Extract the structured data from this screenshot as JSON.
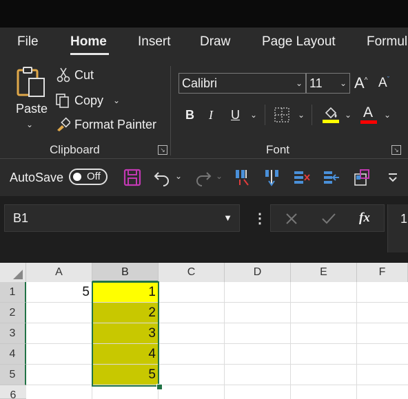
{
  "ribbon": {
    "tabs": [
      "File",
      "Home",
      "Insert",
      "Draw",
      "Page Layout",
      "Formul"
    ],
    "active_tab": "Home",
    "clipboard": {
      "paste_label": "Paste",
      "cut_label": "Cut",
      "copy_label": "Copy",
      "format_painter_label": "Format Painter",
      "group_label": "Clipboard"
    },
    "font": {
      "font_name": "Calibri",
      "font_size": "11",
      "bold": "B",
      "italic": "I",
      "underline": "U",
      "font_color_letter": "A",
      "grow_label": "A",
      "shrink_label": "A",
      "group_label": "Font",
      "highlight_color": "#ffff00",
      "font_color": "#ff0000"
    }
  },
  "qat": {
    "autosave_label": "AutoSave",
    "autosave_state": "Off"
  },
  "formula_bar": {
    "name_box": "B1",
    "fx_label": "fx",
    "formula_value": "1"
  },
  "sheet": {
    "columns": [
      "A",
      "B",
      "C",
      "D",
      "E",
      "F"
    ],
    "rows": [
      "1",
      "2",
      "3",
      "4",
      "5",
      "6"
    ],
    "cells": {
      "A1": "5",
      "B1": "1",
      "B2": "2",
      "B3": "3",
      "B4": "4",
      "B5": "5"
    },
    "selected_column": "B",
    "colors": {
      "B1_fill": "#ffff00",
      "B2_B5_fill": "#c8c800",
      "selection_border": "#217346"
    }
  }
}
